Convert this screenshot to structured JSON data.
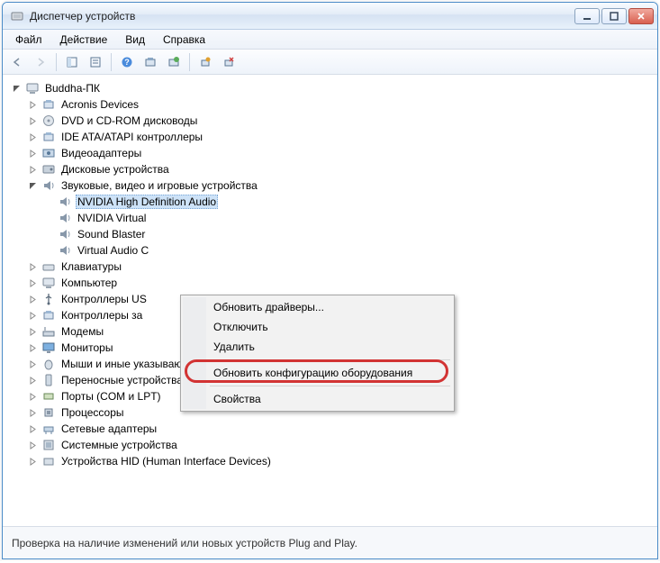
{
  "window": {
    "title": "Диспетчер устройств"
  },
  "menu": {
    "file": "Файл",
    "action": "Действие",
    "view": "Вид",
    "help": "Справка"
  },
  "tree": {
    "root": "Buddha-ПК",
    "nodes": [
      {
        "label": "Acronis Devices"
      },
      {
        "label": "DVD и CD-ROM дисководы"
      },
      {
        "label": "IDE ATA/ATAPI контроллеры"
      },
      {
        "label": "Видеоадаптеры"
      },
      {
        "label": "Дисковые устройства"
      },
      {
        "label": "Звуковые, видео и игровые устройства",
        "expanded": true,
        "children": [
          {
            "label": "NVIDIA High Definition Audio",
            "selected": true
          },
          {
            "label": "NVIDIA Virtual"
          },
          {
            "label": "Sound Blaster"
          },
          {
            "label": "Virtual Audio C"
          }
        ]
      },
      {
        "label": "Клавиатуры"
      },
      {
        "label": "Компьютер"
      },
      {
        "label": "Контроллеры US"
      },
      {
        "label": "Контроллеры за"
      },
      {
        "label": "Модемы"
      },
      {
        "label": "Мониторы"
      },
      {
        "label": "Мыши и иные указывающие устройства"
      },
      {
        "label": "Переносные устройства"
      },
      {
        "label": "Порты (COM и LPT)"
      },
      {
        "label": "Процессоры"
      },
      {
        "label": "Сетевые адаптеры"
      },
      {
        "label": "Системные устройства"
      },
      {
        "label": "Устройства HID (Human Interface Devices)"
      }
    ]
  },
  "context": {
    "update_drivers": "Обновить драйверы...",
    "disable": "Отключить",
    "uninstall": "Удалить",
    "scan_hw": "Обновить конфигурацию оборудования",
    "properties": "Свойства"
  },
  "status": "Проверка на наличие изменений или новых устройств Plug and Play."
}
